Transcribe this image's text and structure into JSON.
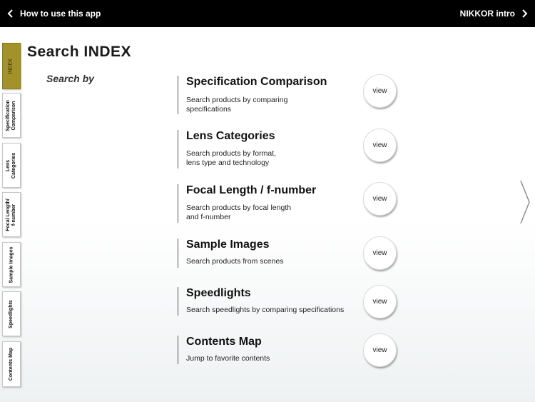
{
  "topbar": {
    "back_label": "How to use this app",
    "forward_label": "NIKKOR intro"
  },
  "tabs": [
    {
      "label": "INDEX",
      "active": true
    },
    {
      "label": "Specification\nComparison",
      "active": false
    },
    {
      "label": "Lens\nCategories",
      "active": false
    },
    {
      "label": "Focal Length/\nf-number",
      "active": false
    },
    {
      "label": "Sample Images",
      "active": false
    },
    {
      "label": "Speedlights",
      "active": false
    },
    {
      "label": "Contents Map",
      "active": false
    }
  ],
  "page": {
    "title": "Search INDEX",
    "subhead": "Search by"
  },
  "entries": [
    {
      "title": "Specification Comparison",
      "desc": "Search products by comparing\nspecifications",
      "button": "view"
    },
    {
      "title": "Lens Categories",
      "desc": "Search products by format,\nlens type and technology",
      "button": "view"
    },
    {
      "title": "Focal Length / f-number",
      "desc": "Search products by focal length\nand f-number",
      "button": "view"
    },
    {
      "title": "Sample Images",
      "desc": "Search products from scenes",
      "button": "view"
    },
    {
      "title": "Speedlights",
      "desc": "Search speedlights by comparing specifications",
      "button": "view"
    },
    {
      "title": "Contents Map",
      "desc": "Jump to favorite contents",
      "button": "view"
    }
  ],
  "colors": {
    "topbar": "#000000",
    "active_tab": "#a39129"
  },
  "icons": {
    "back": "chevron-left-icon",
    "forward": "chevron-right-icon",
    "next_page": "next-page-arrow-icon"
  }
}
